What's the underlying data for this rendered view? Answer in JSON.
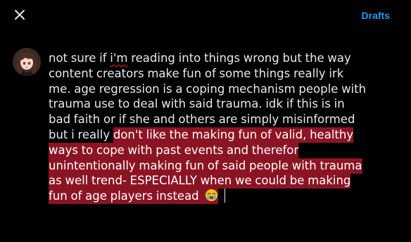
{
  "header": {
    "close_icon": "close-icon",
    "drafts_label": "Drafts"
  },
  "avatar": {
    "icon": "avatar"
  },
  "compose": {
    "line1_a": "not sure if ",
    "line1_b": "i'm",
    "line1_c": " reading into things wrong but the way",
    "line2": "content creators make fun of some things really irk",
    "line3": "me. age regression is a coping mechanism people with",
    "line4": "trauma use to deal with said trauma. idk if this is in",
    "line5": "bad faith or if she and others are simply misinformed",
    "line6_plain": "but i really ",
    "line6_hl": "don't like the making fun of valid, healthy",
    "line7": "ways to cope with past events and therefor",
    "line8": "unintentionally making fun of said people with trauma",
    "line9": "as well trend- ESPECIALLY when we could be making",
    "line10": "fun of age players instead ",
    "emoji": "loudly-crying-face"
  },
  "colors": {
    "background": "#000000",
    "text": "#e7e9ea",
    "accent": "#1d9bf0",
    "highlight": "#8b1424"
  }
}
